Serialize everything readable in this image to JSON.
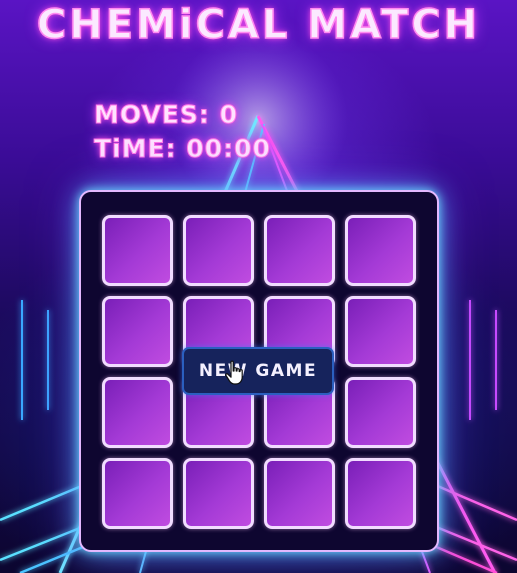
{
  "game": {
    "title": "CHEMiCAL MATCH",
    "moves_label": "MOVES: 0",
    "time_label": "TiME: 00:00",
    "new_game_label": "NEW GAME"
  },
  "board": {
    "rows": 4,
    "columns": 4,
    "cards_face_down": 16
  },
  "colors": {
    "title_glow": "#ff4fd8",
    "card_fill": "#a43ad6",
    "card_border": "#f1dcff",
    "board_glow": "#6fd8ff",
    "button_fill": "#16235c"
  },
  "icons": {
    "cursor": "hand-pointer-icon"
  }
}
